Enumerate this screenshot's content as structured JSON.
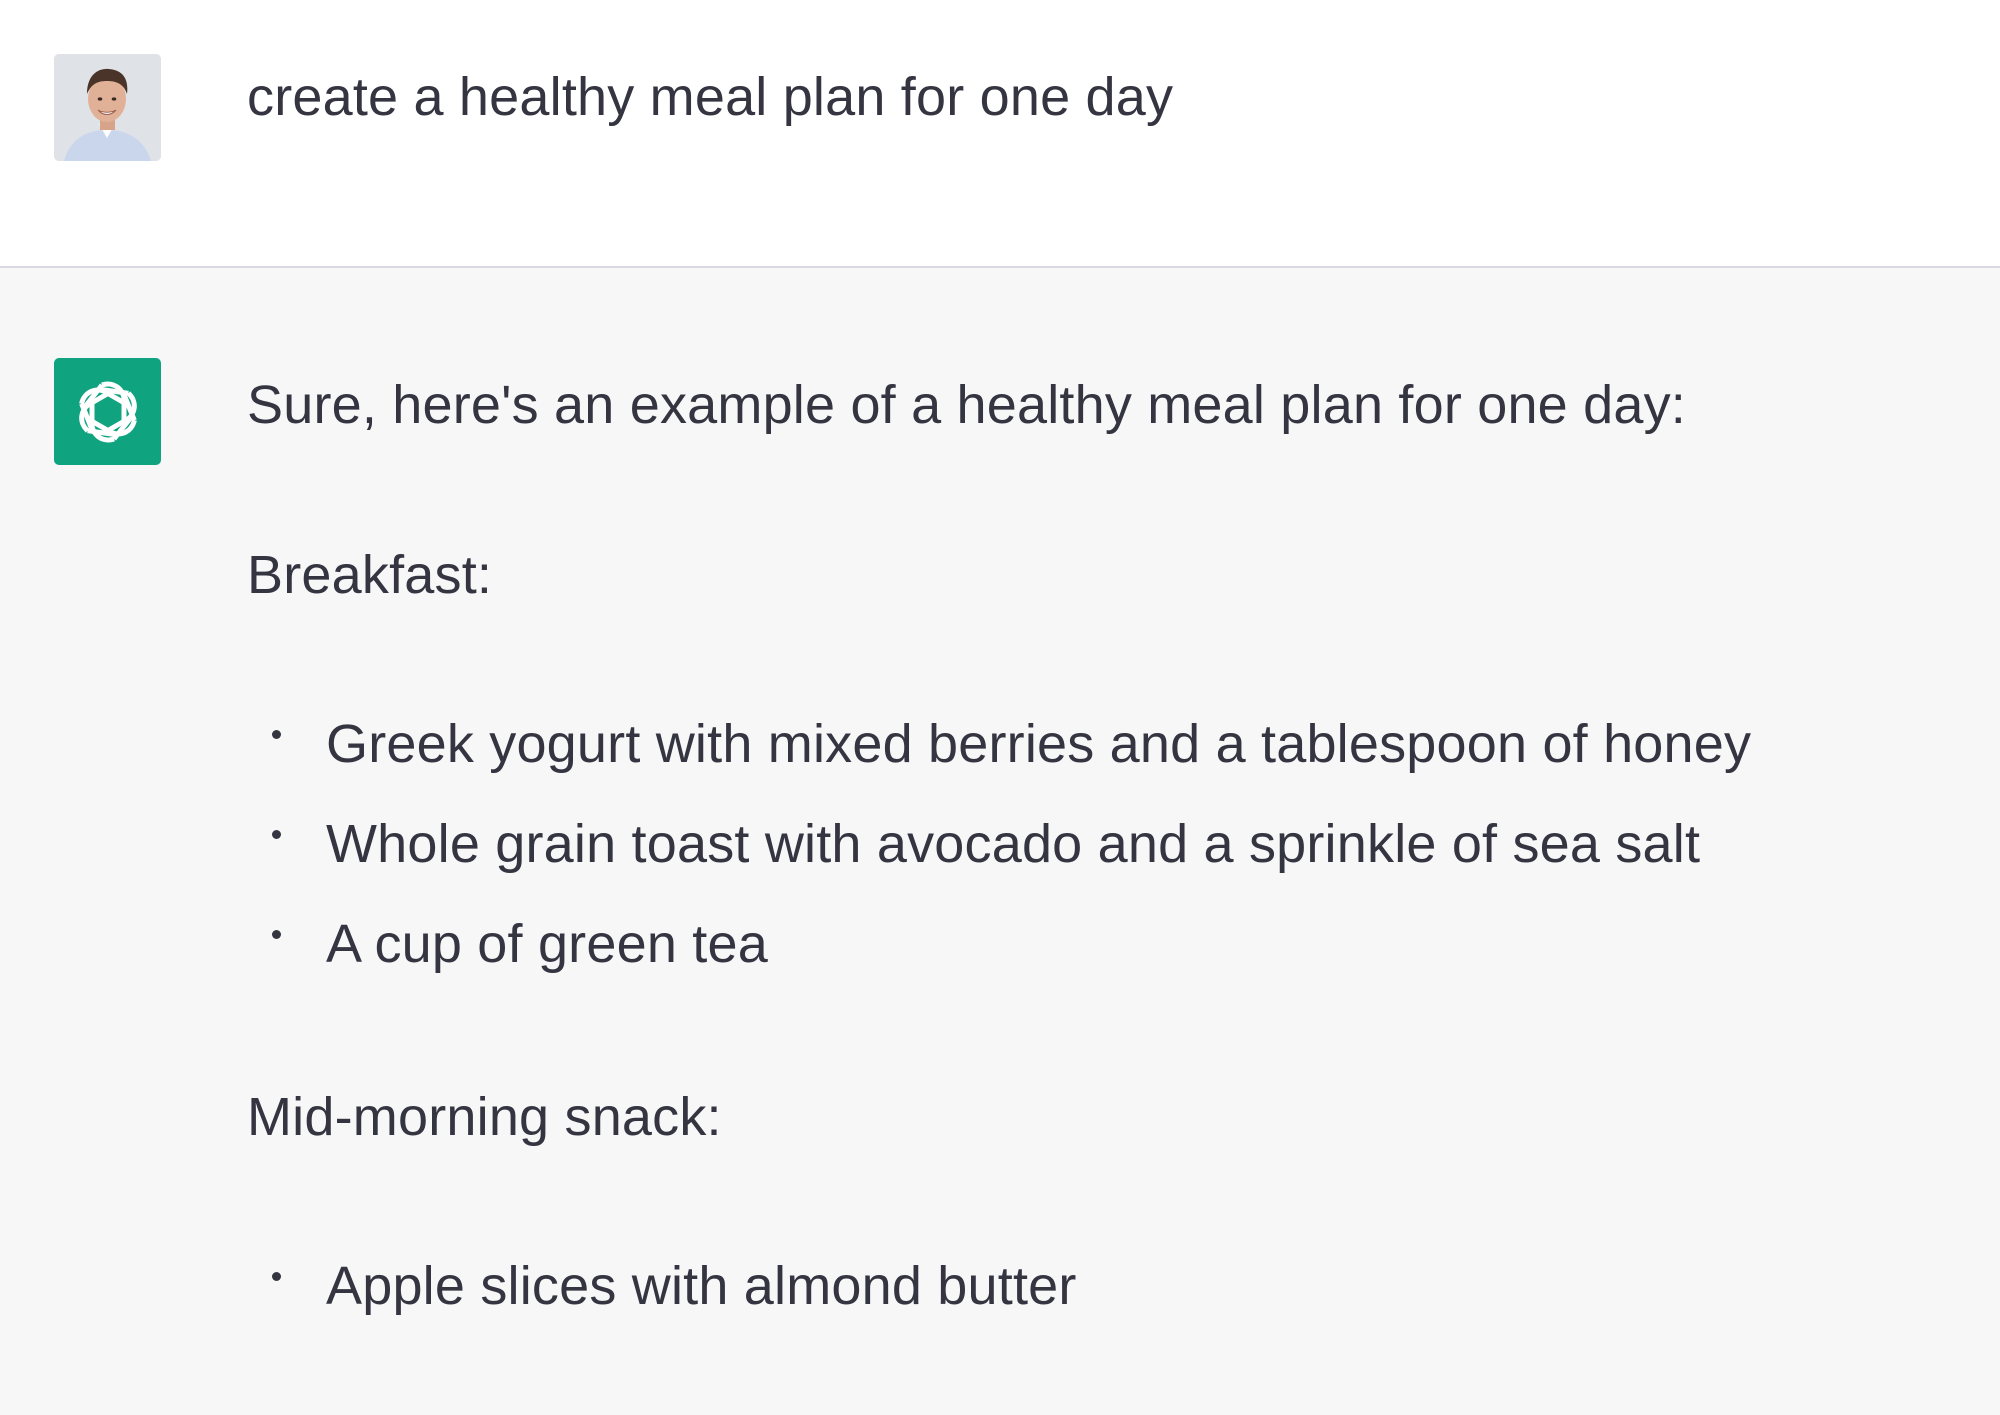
{
  "user_message": {
    "text": "create a healthy meal plan for one day"
  },
  "assistant_message": {
    "accent_color": "#10a37f",
    "intro": "Sure, here's an example of a healthy meal plan for one day:",
    "sections": [
      {
        "heading": "Breakfast:",
        "items": [
          "Greek yogurt with mixed berries and a tablespoon of honey",
          "Whole grain toast with avocado and a sprinkle of sea salt",
          "A cup of green tea"
        ]
      },
      {
        "heading": "Mid-morning snack:",
        "items": [
          "Apple slices with almond butter"
        ]
      }
    ]
  }
}
